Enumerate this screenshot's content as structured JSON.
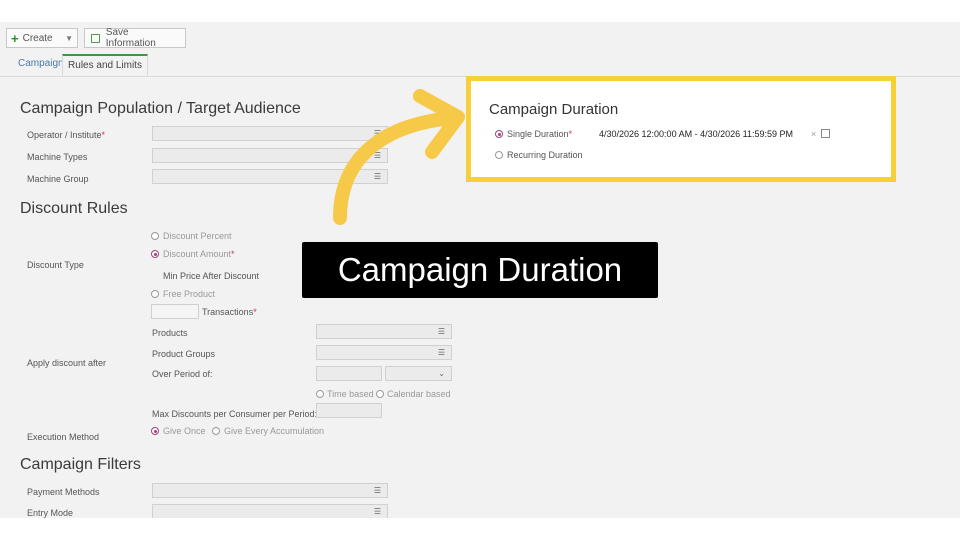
{
  "toolbar": {
    "create_label": "Create",
    "save_label": "Save Information"
  },
  "tabs": [
    {
      "label": "Campaign"
    },
    {
      "label": "Rules and Limits"
    }
  ],
  "population": {
    "title": "Campaign Population / Target Audience",
    "fields": [
      {
        "label": "Operator / Institute",
        "required": "*"
      },
      {
        "label": "Machine Types"
      },
      {
        "label": "Machine Group"
      }
    ]
  },
  "discount": {
    "title": "Discount Rules",
    "type_label": "Discount Type",
    "options": {
      "percent": "Discount Percent",
      "amount": "Discount Amount",
      "amount_req": "*",
      "min_price": "Min Price After Discount",
      "free": "Free Product",
      "transactions": "Transactions",
      "transactions_req": "*"
    },
    "apply_label": "Apply discount after",
    "products": "Products",
    "product_groups": "Product Groups",
    "over_period": "Over Period of:",
    "time_based": "Time based",
    "calendar_based": "Calendar based",
    "max_discounts": "Max Discounts per Consumer per Period:",
    "execution_label": "Execution Method",
    "give_once": "Give Once",
    "give_every": "Give Every Accumulation"
  },
  "filters": {
    "title": "Campaign Filters",
    "payment": "Payment Methods",
    "entry": "Entry Mode"
  },
  "duration": {
    "title": "Campaign Duration",
    "single": "Single Duration",
    "single_req": "*",
    "recurring": "Recurring Duration",
    "value": "4/30/2026 12:00:00 AM - 4/30/2026 11:59:59 PM",
    "clear": "×"
  },
  "caption": "Campaign Duration",
  "colors": {
    "highlight": "#f7d038",
    "arrow": "#f7c948",
    "tab_accent": "#3c9a3c"
  },
  "icons": [
    "plus-icon",
    "save-icon",
    "list-icon",
    "calendar-icon",
    "arrow-icon"
  ]
}
